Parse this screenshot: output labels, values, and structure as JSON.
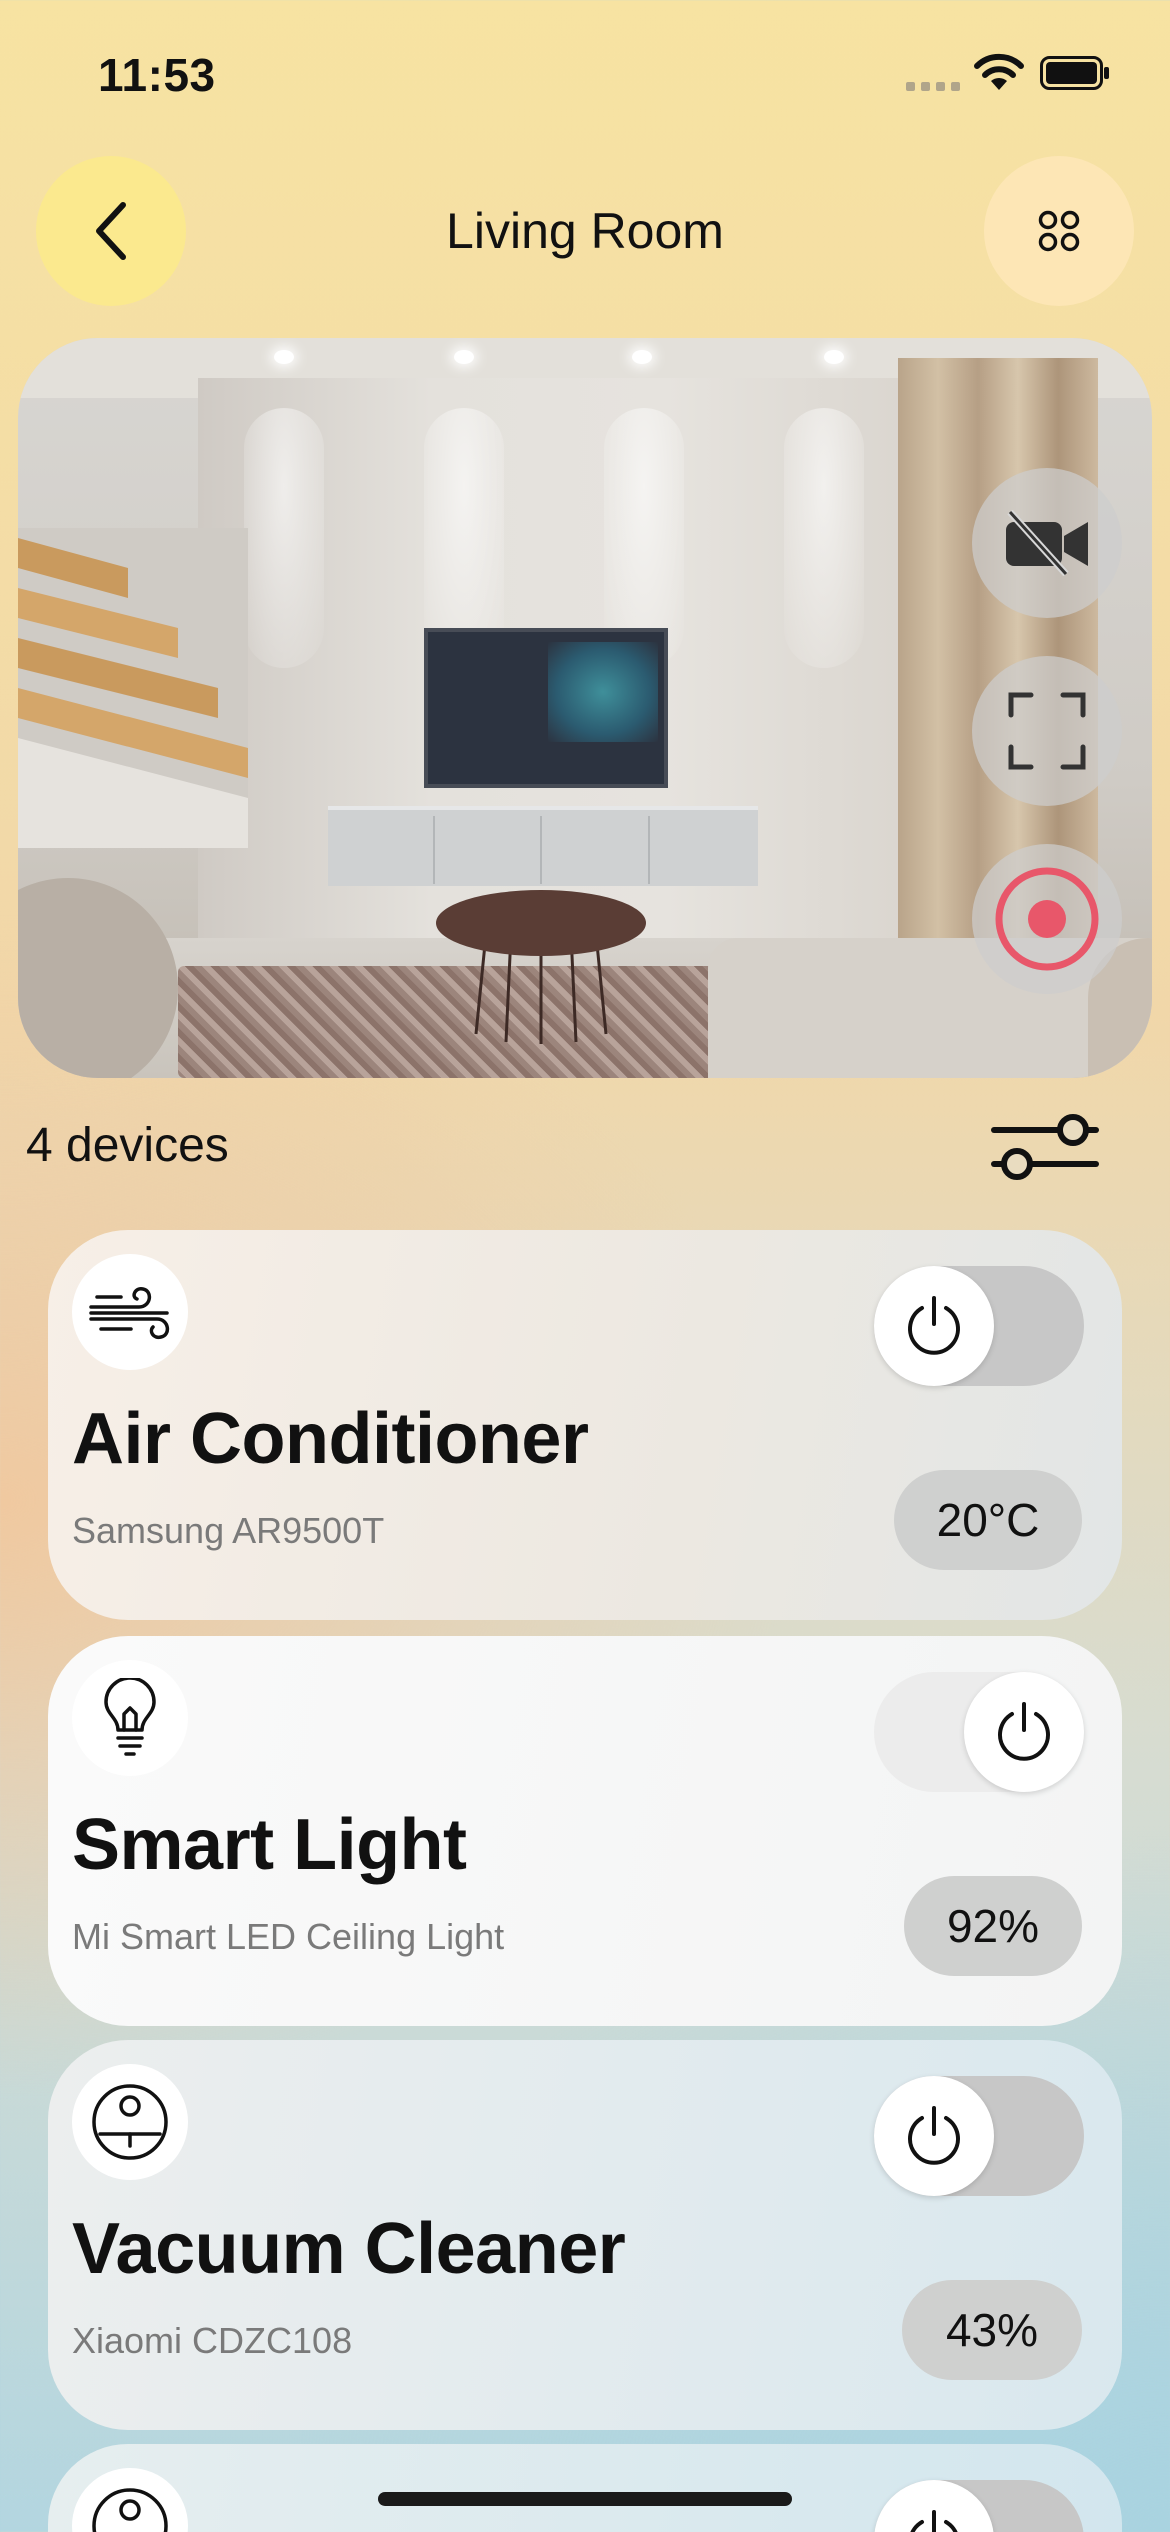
{
  "status_bar": {
    "time": "11:53"
  },
  "header": {
    "title": "Living Room",
    "back_icon": "chevron-left-icon",
    "menu_icon": "four-dots-grid-icon"
  },
  "camera": {
    "controls": [
      {
        "icon": "video-off-icon"
      },
      {
        "icon": "fullscreen-icon"
      },
      {
        "icon": "record-icon",
        "color": "#e8576a"
      }
    ]
  },
  "devices_summary": {
    "count_label": "4 devices",
    "filter_icon": "sliders-icon"
  },
  "devices": [
    {
      "icon": "wind-icon",
      "name": "Air Conditioner",
      "model": "Samsung AR9500T",
      "value": "20°C",
      "power": "off"
    },
    {
      "icon": "lightbulb-icon",
      "name": "Smart Light",
      "model": "Mi Smart LED Ceiling Light",
      "value": "92%",
      "power": "on"
    },
    {
      "icon": "robot-vacuum-icon",
      "name": "Vacuum Cleaner",
      "model": "Xiaomi CDZC108",
      "value": "43%",
      "power": "off"
    }
  ],
  "colors": {
    "accent_yellow": "#fbe98e",
    "record_red": "#e8576a"
  }
}
